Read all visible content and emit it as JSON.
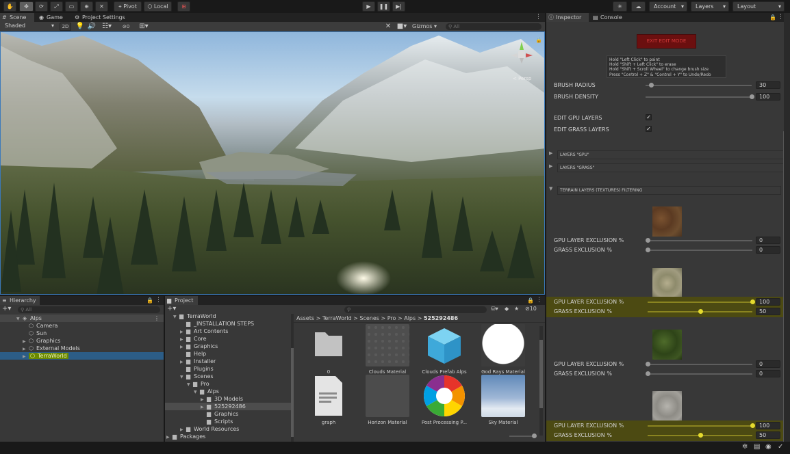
{
  "toolbar": {
    "tools": [
      "hand-tool-icon",
      "move-tool-icon",
      "rotate-tool-icon",
      "scale-tool-icon",
      "rect-tool-icon",
      "transform-tool-icon",
      "custom-tool-icon"
    ],
    "pivot_label": "Pivot",
    "local_label": "Local",
    "play_controls": [
      "play-icon",
      "pause-icon",
      "step-icon"
    ],
    "account_label": "Account",
    "layers_label": "Layers",
    "layout_label": "Layout"
  },
  "scene": {
    "tabs": [
      "Scene",
      "Game",
      "Project Settings"
    ],
    "shading_mode": "Shaded",
    "mode_2d": "2D",
    "hidden_count": "0",
    "gizmos_label": "Gizmos",
    "search_placeholder": "All",
    "persp_label": "< Persp"
  },
  "inspector": {
    "tabs": [
      "Inspector",
      "Console"
    ],
    "exit_button": "EXIT EDIT MODE",
    "help_lines": [
      "Hold  \"Left Click\"  to paint",
      "Hold  \"Shift + Left Click\"  to erase",
      "Hold  \"Shift + Scroll Wheel\"  to change brush size",
      "Press  \"Control + Z\"  &  \"Control + Y\"  to Undo/Redo"
    ],
    "brush_radius_label": "BRUSH RADIUS",
    "brush_radius_value": "30",
    "brush_radius_level": 0.05,
    "brush_density_label": "BRUSH DENSITY",
    "brush_density_value": "100",
    "brush_density_level": 1.0,
    "edit_gpu_label": "EDIT GPU LAYERS",
    "edit_grass_label": "EDIT GRASS LAYERS",
    "edit_gpu_checked": "✓",
    "edit_grass_checked": "✓",
    "foldouts": [
      "LAYERS \"GPU\"",
      "LAYERS \"GRASS\"",
      "TERRAIN LAYERS (TEXTURES) FILTERING"
    ],
    "gpu_exclusion_label": "GPU LAYER EXCLUSION  %",
    "grass_exclusion_label": "GRASS EXCLUSION  %",
    "layers": [
      {
        "gpu": "0",
        "grass": "0",
        "gpu_level": 0.0,
        "grass_level": 0.0,
        "highlight": false
      },
      {
        "gpu": "100",
        "grass": "50",
        "gpu_level": 1.0,
        "grass_level": 0.5,
        "highlight": true
      },
      {
        "gpu": "0",
        "grass": "0",
        "gpu_level": 0.0,
        "grass_level": 0.0,
        "highlight": false
      },
      {
        "gpu": "100",
        "grass": "50",
        "gpu_level": 1.0,
        "grass_level": 0.5,
        "highlight": true
      }
    ],
    "colors": {
      "highlight": "#4c4a12",
      "exit_button": "#6b0f0f",
      "exit_text": "#d23a3a"
    }
  },
  "hierarchy": {
    "title": "Hierarchy",
    "search_placeholder": "All",
    "root": "Alps",
    "items": [
      "Camera",
      "Sun",
      "Graphics",
      "External Models",
      "TerraWorld"
    ],
    "selected": "TerraWorld"
  },
  "project": {
    "title": "Project",
    "tree": [
      "TerraWorld",
      "_INSTALLATION STEPS",
      "Art Contents",
      "Core",
      "Graphics",
      "Help",
      "Installer",
      "Plugins",
      "Scenes",
      "Pro",
      "Alps",
      "3D Models",
      "525292486",
      "Graphics",
      "Scripts",
      "World Resources",
      "Packages"
    ],
    "breadcrumb": [
      "Assets",
      "TerraWorld",
      "Scenes",
      "Pro",
      "Alps",
      "525292486"
    ],
    "hidden_packages_count": "10",
    "assets": [
      "0",
      "Clouds Material",
      "Clouds Prefab Alps",
      "God Rays Material",
      "graph",
      "Horizon Material",
      "Post Processing P...",
      "Sky Material"
    ]
  }
}
